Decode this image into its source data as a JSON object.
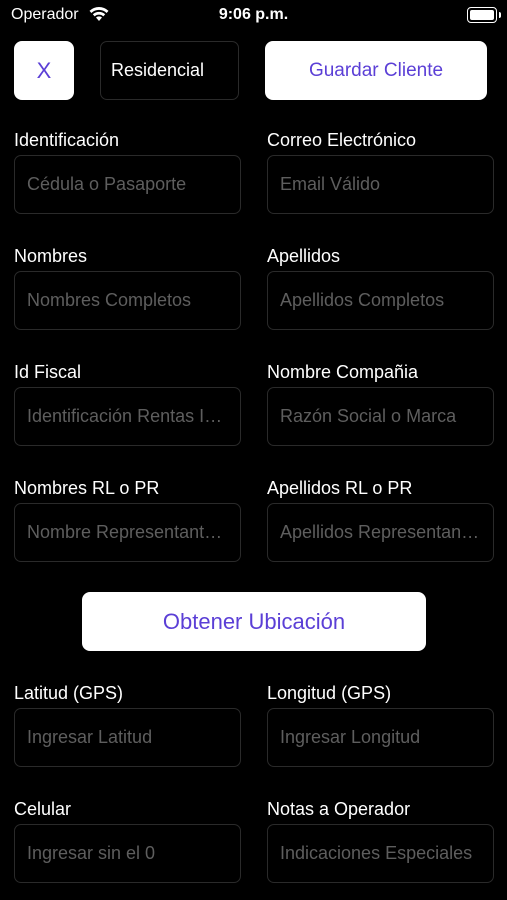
{
  "status_bar": {
    "carrier": "Operador",
    "time": "9:06 p.m."
  },
  "header": {
    "close_label": "X",
    "client_type": "Residencial",
    "save_label": "Guardar Cliente"
  },
  "fields": [
    {
      "label": "Identificación",
      "placeholder": "Cédula o Pasaporte",
      "value": ""
    },
    {
      "label": "Correo Electrónico",
      "placeholder": "Email Válido",
      "value": ""
    },
    {
      "label": "Nombres",
      "placeholder": "Nombres Completos",
      "value": ""
    },
    {
      "label": "Apellidos",
      "placeholder": "Apellidos Completos",
      "value": ""
    },
    {
      "label": "Id Fiscal",
      "placeholder": "Identificación Rentas Internas",
      "value": ""
    },
    {
      "label": "Nombre Compañia",
      "placeholder": "Razón Social o Marca",
      "value": ""
    },
    {
      "label": "Nombres RL o PR",
      "placeholder": "Nombre Representante Legal",
      "value": ""
    },
    {
      "label": "Apellidos RL o PR",
      "placeholder": "Apellidos Representante Legal",
      "value": ""
    },
    {
      "label": "Latitud (GPS)",
      "placeholder": "Ingresar Latitud",
      "value": ""
    },
    {
      "label": "Longitud (GPS)",
      "placeholder": "Ingresar Longitud",
      "value": ""
    },
    {
      "label": "Celular",
      "placeholder": "Ingresar sin el 0",
      "value": ""
    },
    {
      "label": "Notas a Operador",
      "placeholder": "Indicaciones Especiales",
      "value": ""
    }
  ],
  "location_button_label": "Obtener Ubicación",
  "colors": {
    "background": "#000000",
    "accent": "#5b3fd6",
    "button_bg": "#ffffff",
    "placeholder": "#5e5e5e"
  },
  "icons": {
    "wifi": "wifi-icon",
    "battery": "battery-icon"
  }
}
